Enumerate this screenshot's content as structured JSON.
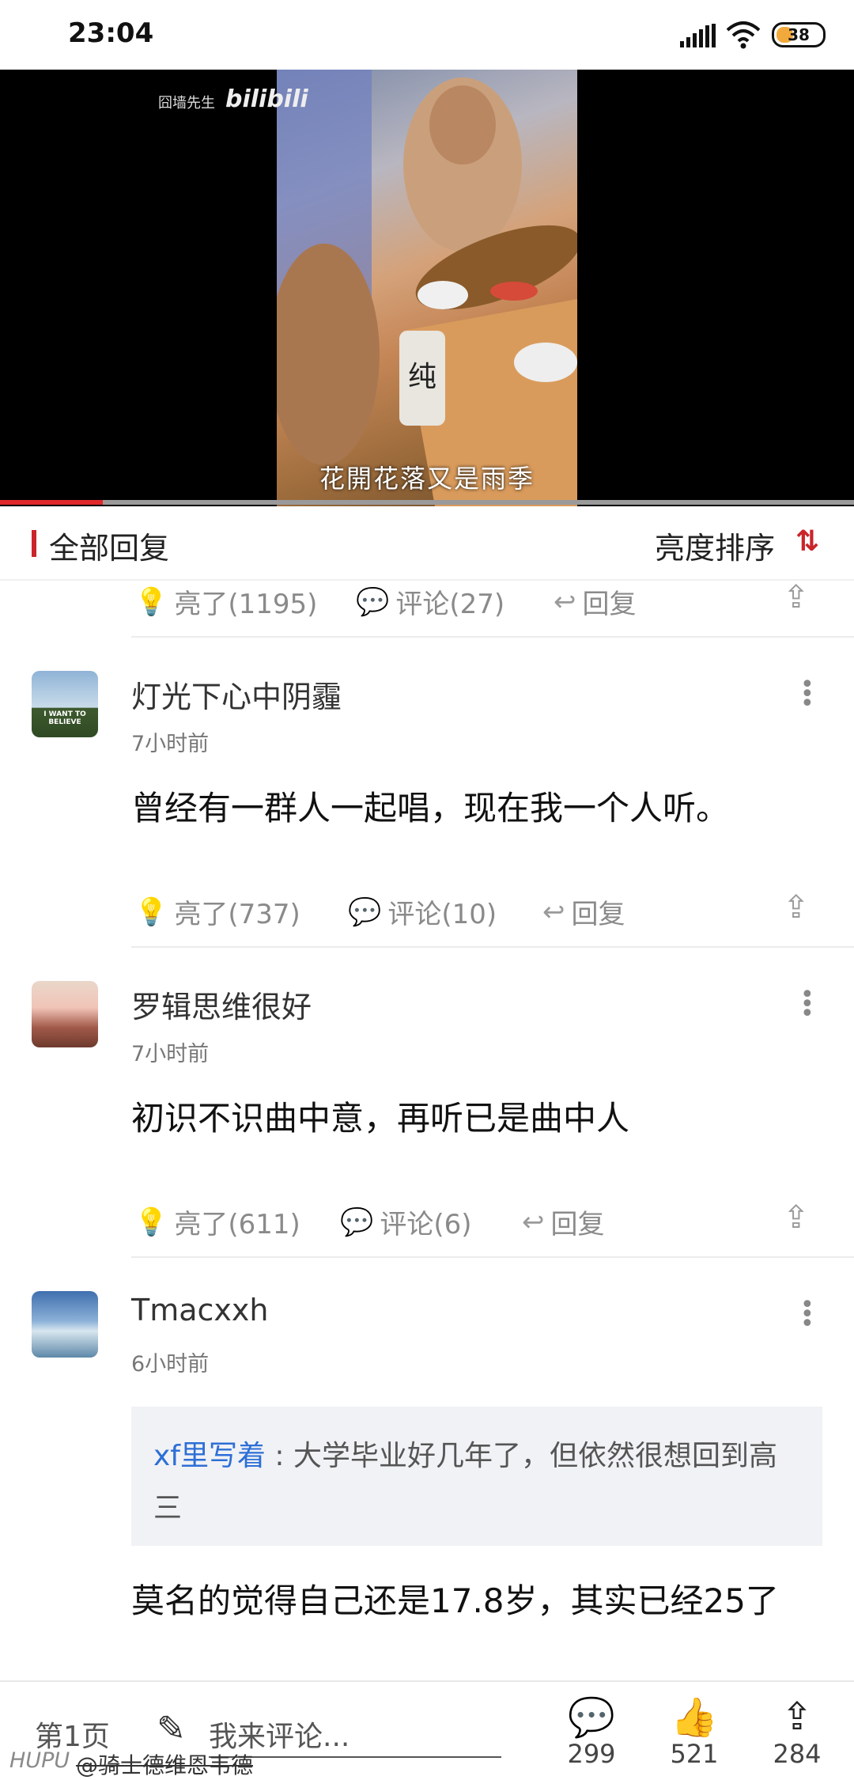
{
  "status_bar": {
    "time": "23:04",
    "battery": "38",
    "battery_level": 0.38
  },
  "video": {
    "watermark_text": "囧墙先生",
    "watermark_logo": "bilibili",
    "subtitle": "花開花落又是雨季",
    "progress": 0.12
  },
  "replies_header": {
    "title": "全部回复",
    "sort_label": "亮度排序"
  },
  "top_actions": {
    "like": "亮了(1195)",
    "comment": "评论(27)",
    "reply": "回复"
  },
  "comments": [
    {
      "username": "灯光下心中阴霾",
      "time": "7小时前",
      "body": "曾经有一群人一起唱，现在我一个人听。",
      "like": "亮了(737)",
      "comment": "评论(10)",
      "reply": "回复",
      "avatar_caption": "I WANT TO BELIEVE"
    },
    {
      "username": "罗辑思维很好",
      "time": "7小时前",
      "body": "初识不识曲中意，再听已是曲中人",
      "like": "亮了(611)",
      "comment": "评论(6)",
      "reply": "回复"
    },
    {
      "username": "Tmacxxh",
      "time": "6小时前",
      "quote_user": "xf里写着",
      "quote_text": "大学毕业好几年了，但依然很想回到高三",
      "body": "莫名的觉得自己还是17.8岁，其实已经25了"
    }
  ],
  "bottom_bar": {
    "page": "第1页",
    "input_placeholder": "我来评论...",
    "comments_count": "299",
    "likes_count": "521",
    "shares_count": "284"
  },
  "watermark": {
    "app": "HUPU",
    "author": "@骑士德维恩韦德"
  },
  "colors": {
    "accent": "#c9252b",
    "quote_user": "#2d6fd6",
    "progress": "#e0282a"
  }
}
